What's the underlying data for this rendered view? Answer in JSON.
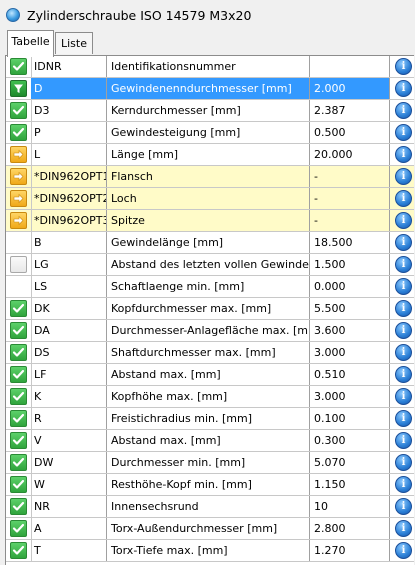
{
  "window": {
    "title": "Zylinderschraube ISO 14579 M3x20"
  },
  "tabs": [
    {
      "label": "Tabelle",
      "active": true
    },
    {
      "label": "Liste",
      "active": false
    }
  ],
  "colors": {
    "selection": "#3399ff",
    "highlight_row": "#fffbc8",
    "check": "#2fa43c",
    "arrow": "#f0a818",
    "info": "#2b7fd6"
  },
  "rows": [
    {
      "state": "check",
      "name": "IDNR",
      "desc": "Identifikationsnummer",
      "value": ""
    },
    {
      "state": "filter",
      "name": "D",
      "desc": "Gewindenenndurchmesser [mm]",
      "value": "2.000",
      "selected": true
    },
    {
      "state": "check",
      "name": "D3",
      "desc": "Kerndurchmesser [mm]",
      "value": "2.387"
    },
    {
      "state": "check",
      "name": "P",
      "desc": "Gewindesteigung [mm]",
      "value": "0.500"
    },
    {
      "state": "arrow",
      "name": "L",
      "desc": "Länge [mm]",
      "value": "20.000"
    },
    {
      "state": "arrow",
      "name": "*DIN962OPT1",
      "desc": "Flansch",
      "value": "-",
      "highlight": true
    },
    {
      "state": "arrow",
      "name": "*DIN962OPT2",
      "desc": "Loch",
      "value": "-",
      "highlight": true
    },
    {
      "state": "arrow",
      "name": "*DIN962OPT3",
      "desc": "Spitze",
      "value": "-",
      "highlight": true
    },
    {
      "state": "none",
      "name": "B",
      "desc": "Gewindelänge [mm]",
      "value": "18.500"
    },
    {
      "state": "empty",
      "name": "LG",
      "desc": "Abstand des letzten vollen Gewindeganges",
      "value": "1.500"
    },
    {
      "state": "none",
      "name": "LS",
      "desc": "Schaftlaenge min. [mm]",
      "value": "0.000"
    },
    {
      "state": "check",
      "name": "DK",
      "desc": "Kopfdurchmesser max. [mm]",
      "value": "5.500"
    },
    {
      "state": "check",
      "name": "DA",
      "desc": "Durchmesser-Anlagefläche max. [mm]",
      "value": "3.600"
    },
    {
      "state": "check",
      "name": "DS",
      "desc": "Shaftdurchmesser max. [mm]",
      "value": "3.000"
    },
    {
      "state": "check",
      "name": "LF",
      "desc": "Abstand max. [mm]",
      "value": "0.510"
    },
    {
      "state": "check",
      "name": "K",
      "desc": "Kopfhöhe max. [mm]",
      "value": "3.000"
    },
    {
      "state": "check",
      "name": "R",
      "desc": "Freistichradius min. [mm]",
      "value": "0.100"
    },
    {
      "state": "check",
      "name": "V",
      "desc": "Abstand max. [mm]",
      "value": "0.300"
    },
    {
      "state": "check",
      "name": "DW",
      "desc": "Durchmesser min. [mm]",
      "value": "5.070"
    },
    {
      "state": "check",
      "name": "W",
      "desc": "Resthöhe-Kopf min. [mm]",
      "value": "1.150"
    },
    {
      "state": "check",
      "name": "NR",
      "desc": "Innensechsrund",
      "value": "10"
    },
    {
      "state": "check",
      "name": "A",
      "desc": "Torx-Außendurchmesser [mm]",
      "value": "2.800"
    },
    {
      "state": "check",
      "name": "T",
      "desc": "Torx-Tiefe max. [mm]",
      "value": "1.270"
    }
  ]
}
